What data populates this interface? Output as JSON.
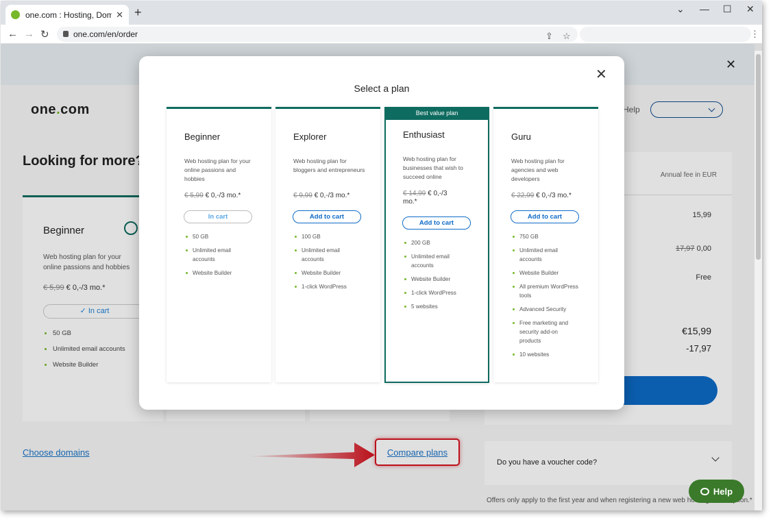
{
  "browser": {
    "tab_title": "one.com : Hosting, Domain, Email",
    "tab_close": "✕",
    "new_tab": "+",
    "url": "one.com/en/order",
    "win_min": "⌄",
    "win_minimize": "—",
    "win_max": "☐",
    "win_close": "✕"
  },
  "page": {
    "logo_a": "one",
    "logo_dot": ".",
    "logo_b": "com",
    "help": "Help",
    "heading": "Looking for more?",
    "bg_plan": {
      "name": "Beginner",
      "desc": "Web hosting plan for your online passions and hobbies",
      "old_price": "€ 5,99",
      "price": "€ 0,-/3 mo.*",
      "in_cart": "✓ In cart",
      "features": [
        "50 GB",
        "Unlimited email accounts",
        "Website Builder"
      ]
    },
    "summary": {
      "header": "Annual fee in EUR",
      "v1": "15,99",
      "v2_old": "17,97",
      "v2": "0,00",
      "v3": "Free",
      "total": "€15,99",
      "discount": "-17,97"
    },
    "choose_domains": "Choose domains",
    "compare_plans": "Compare plans",
    "voucher": "Do you have a voucher code?",
    "offers": "Offers only apply to the first year and when registering a new web hosting subscription.*",
    "help_btn": "Help"
  },
  "modal": {
    "title": "Select a plan",
    "close": "✕",
    "plans": [
      {
        "name": "Beginner",
        "desc": "Web hosting plan for your online passions and hobbies",
        "old_price": "€ 5,99",
        "price": "€ 0,-/3 mo.*",
        "button": "In cart",
        "features": [
          "50 GB",
          "Unlimited email accounts",
          "Website Builder"
        ]
      },
      {
        "name": "Explorer",
        "desc": "Web hosting plan for bloggers and entrepreneurs",
        "old_price": "€ 9,99",
        "price": "€ 0,-/3 mo.*",
        "button": "Add to cart",
        "features": [
          "100 GB",
          "Unlimited email accounts",
          "Website Builder",
          "1-click WordPress"
        ]
      },
      {
        "tag": "Best value plan",
        "name": "Enthusiast",
        "desc": "Web hosting plan for businesses that wish to succeed online",
        "old_price": "€ 14,99",
        "price": "€ 0,-/3 mo.*",
        "button": "Add to cart",
        "features": [
          "200 GB",
          "Unlimited email accounts",
          "Website Builder",
          "1-click WordPress",
          "5 websites"
        ]
      },
      {
        "name": "Guru",
        "desc": "Web hosting plan for agencies and web developers",
        "old_price": "€ 22,99",
        "price": "€ 0,-/3 mo.*",
        "button": "Add to cart",
        "features": [
          "750 GB",
          "Unlimited email accounts",
          "Website Builder",
          "All premium WordPress tools",
          "Advanced Security",
          "Free marketing and security add-on products",
          "10 websites"
        ]
      }
    ]
  },
  "colors": {
    "brand_green": "#0e6b5f",
    "accent_lime": "#76b82a",
    "link_blue": "#1a73c8",
    "highlight_red": "#d5131f"
  }
}
